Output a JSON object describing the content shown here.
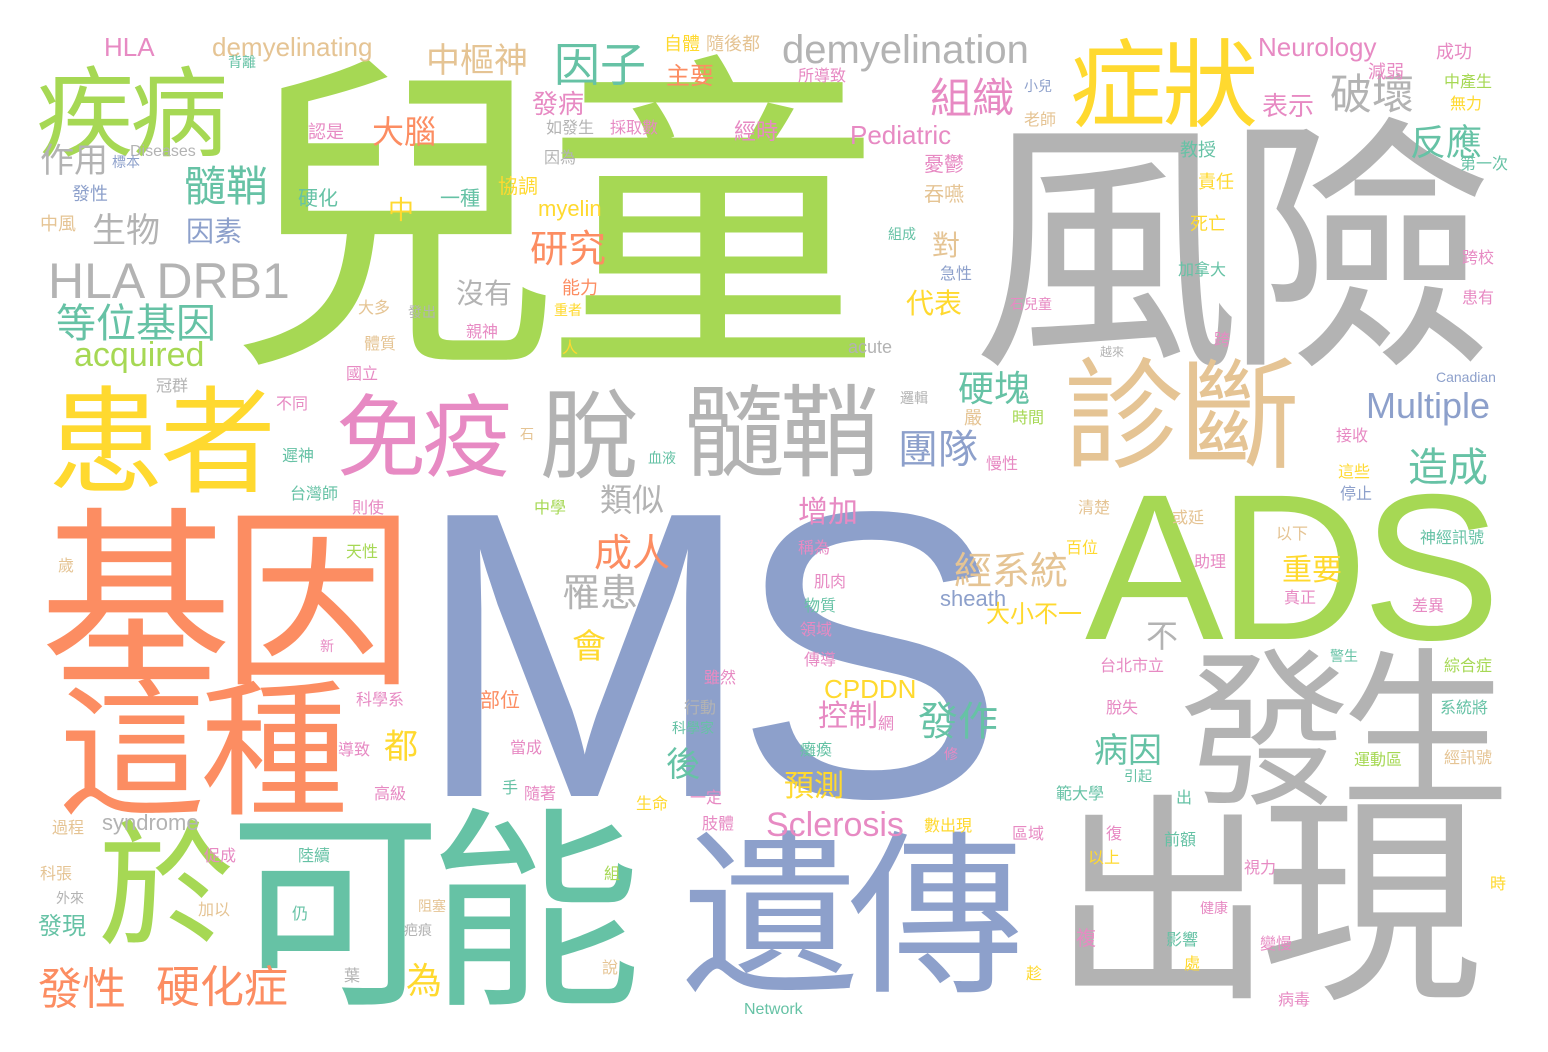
{
  "colors": {
    "green": "#a6d854",
    "blue": "#8da0cb",
    "orange": "#fc8d62",
    "teal": "#66c2a5",
    "gray": "#b3b3b3",
    "yellow": "#ffd92f",
    "pink": "#e78ac3",
    "tan": "#e5c494"
  },
  "words": [
    {
      "text": "MS",
      "color": "blue"
    },
    {
      "text": "兒童",
      "color": "green"
    },
    {
      "text": "風險",
      "color": "gray"
    },
    {
      "text": "ADS",
      "color": "green"
    },
    {
      "text": "基因",
      "color": "orange"
    },
    {
      "text": "可能",
      "color": "teal"
    },
    {
      "text": "遺傳",
      "color": "blue"
    },
    {
      "text": "出現",
      "color": "gray"
    },
    {
      "text": "發生",
      "color": "gray"
    },
    {
      "text": "這種",
      "color": "orange"
    },
    {
      "text": "患者",
      "color": "yellow"
    },
    {
      "text": "診斷",
      "color": "tan"
    },
    {
      "text": "疾病",
      "color": "green"
    },
    {
      "text": "症狀",
      "color": "yellow"
    },
    {
      "text": "於",
      "color": "green"
    },
    {
      "text": "免疫",
      "color": "pink"
    },
    {
      "text": "脫",
      "color": "gray"
    },
    {
      "text": "髓鞘",
      "color": "gray"
    },
    {
      "text": "HLA DRB1",
      "color": "gray"
    },
    {
      "text": "demyelination",
      "color": "gray"
    },
    {
      "text": "因子",
      "color": "teal"
    },
    {
      "text": "中樞神",
      "color": "tan"
    },
    {
      "text": "組織",
      "color": "pink"
    },
    {
      "text": "破壞",
      "color": "gray"
    },
    {
      "text": "作用",
      "color": "gray"
    },
    {
      "text": "髓鞘",
      "color": "teal"
    },
    {
      "text": "生物",
      "color": "gray"
    },
    {
      "text": "因素",
      "color": "blue"
    },
    {
      "text": "等位基因",
      "color": "teal"
    },
    {
      "text": "acquired",
      "color": "green"
    },
    {
      "text": "大腦",
      "color": "orange"
    },
    {
      "text": "研究",
      "color": "orange"
    },
    {
      "text": "反應",
      "color": "teal"
    },
    {
      "text": "Multiple",
      "color": "blue"
    },
    {
      "text": "硬塊",
      "color": "teal"
    },
    {
      "text": "團隊",
      "color": "blue"
    },
    {
      "text": "造成",
      "color": "teal"
    },
    {
      "text": "Sclerosis",
      "color": "pink"
    },
    {
      "text": "成人",
      "color": "orange"
    },
    {
      "text": "罹患",
      "color": "gray"
    },
    {
      "text": "類似",
      "color": "gray"
    },
    {
      "text": "發作",
      "color": "teal"
    },
    {
      "text": "經系統",
      "color": "tan"
    },
    {
      "text": "病因",
      "color": "teal"
    },
    {
      "text": "發性",
      "color": "orange"
    },
    {
      "text": "硬化症",
      "color": "orange"
    },
    {
      "text": "Neurology",
      "color": "pink"
    },
    {
      "text": "demyelinating",
      "color": "tan"
    },
    {
      "text": "HLA",
      "color": "pink"
    },
    {
      "text": "Pediatric",
      "color": "pink"
    },
    {
      "text": "myelin",
      "color": "yellow"
    },
    {
      "text": "sheath",
      "color": "blue"
    },
    {
      "text": "CPDDN",
      "color": "yellow"
    },
    {
      "text": "syndrome",
      "color": "gray"
    },
    {
      "text": "acute",
      "color": "gray"
    },
    {
      "text": "Network",
      "color": "teal"
    },
    {
      "text": "Canadian",
      "color": "blue"
    },
    {
      "text": "Diseases",
      "color": "gray"
    },
    {
      "text": "發病",
      "color": "pink"
    },
    {
      "text": "主要",
      "color": "orange"
    },
    {
      "text": "表示",
      "color": "pink"
    },
    {
      "text": "增加",
      "color": "pink"
    },
    {
      "text": "預測",
      "color": "yellow"
    },
    {
      "text": "控制",
      "color": "pink"
    },
    {
      "text": "重要",
      "color": "yellow"
    },
    {
      "text": "為",
      "color": "yellow"
    },
    {
      "text": "都",
      "color": "yellow"
    },
    {
      "text": "後",
      "color": "teal"
    },
    {
      "text": "會",
      "color": "yellow"
    },
    {
      "text": "對",
      "color": "tan"
    },
    {
      "text": "代表",
      "color": "yellow"
    },
    {
      "text": "沒有",
      "color": "gray"
    },
    {
      "text": "不",
      "color": "gray"
    },
    {
      "text": "中",
      "color": "yellow"
    },
    {
      "text": "一種",
      "color": "teal"
    },
    {
      "text": "協調",
      "color": "yellow"
    },
    {
      "text": "硬化",
      "color": "teal"
    },
    {
      "text": "發性",
      "color": "blue"
    },
    {
      "text": "中風",
      "color": "tan"
    },
    {
      "text": "能力",
      "color": "orange"
    },
    {
      "text": "大小不一",
      "color": "yellow"
    },
    {
      "text": "經時",
      "color": "pink"
    },
    {
      "text": "認是",
      "color": "pink"
    },
    {
      "text": "自體",
      "color": "yellow"
    },
    {
      "text": "隨後都",
      "color": "tan"
    },
    {
      "text": "所導致",
      "color": "pink"
    },
    {
      "text": "如發生",
      "color": "gray"
    },
    {
      "text": "採取數",
      "color": "pink"
    },
    {
      "text": "因為",
      "color": "gray"
    },
    {
      "text": "小兒",
      "color": "blue"
    },
    {
      "text": "老師",
      "color": "tan"
    },
    {
      "text": "憂鬱",
      "color": "pink"
    },
    {
      "text": "吞嚥",
      "color": "tan"
    },
    {
      "text": "教授",
      "color": "teal"
    },
    {
      "text": "責任",
      "color": "yellow"
    },
    {
      "text": "死亡",
      "color": "yellow"
    },
    {
      "text": "加拿大",
      "color": "teal"
    },
    {
      "text": "成功",
      "color": "pink"
    },
    {
      "text": "減弱",
      "color": "pink"
    },
    {
      "text": "中產生",
      "color": "green"
    },
    {
      "text": "無力",
      "color": "yellow"
    },
    {
      "text": "第一次",
      "color": "teal"
    },
    {
      "text": "跨校",
      "color": "pink"
    },
    {
      "text": "患有",
      "color": "pink"
    },
    {
      "text": "組成",
      "color": "teal"
    },
    {
      "text": "急性",
      "color": "blue"
    },
    {
      "text": "石兒童",
      "color": "pink"
    },
    {
      "text": "跨",
      "color": "pink"
    },
    {
      "text": "越來",
      "color": "gray"
    },
    {
      "text": "邏輯",
      "color": "gray"
    },
    {
      "text": "嚴",
      "color": "tan"
    },
    {
      "text": "時間",
      "color": "green"
    },
    {
      "text": "慢性",
      "color": "pink"
    },
    {
      "text": "接收",
      "color": "pink"
    },
    {
      "text": "這些",
      "color": "yellow"
    },
    {
      "text": "停止",
      "color": "blue"
    },
    {
      "text": "清楚",
      "color": "tan"
    },
    {
      "text": "或延",
      "color": "tan"
    },
    {
      "text": "百位",
      "color": "yellow"
    },
    {
      "text": "以下",
      "color": "tan"
    },
    {
      "text": "助理",
      "color": "pink"
    },
    {
      "text": "真正",
      "color": "pink"
    },
    {
      "text": "差異",
      "color": "pink"
    },
    {
      "text": "神經訊號",
      "color": "teal"
    },
    {
      "text": "綜合症",
      "color": "green"
    },
    {
      "text": "警生",
      "color": "teal"
    },
    {
      "text": "系統將",
      "color": "teal"
    },
    {
      "text": "經訊號",
      "color": "tan"
    },
    {
      "text": "運動區",
      "color": "green"
    },
    {
      "text": "台北市立",
      "color": "pink"
    },
    {
      "text": "脫失",
      "color": "pink"
    },
    {
      "text": "引起",
      "color": "teal"
    },
    {
      "text": "出",
      "color": "teal"
    },
    {
      "text": "範大學",
      "color": "teal"
    },
    {
      "text": "復",
      "color": "pink"
    },
    {
      "text": "以上",
      "color": "yellow"
    },
    {
      "text": "前額",
      "color": "teal"
    },
    {
      "text": "區域",
      "color": "pink"
    },
    {
      "text": "數出現",
      "color": "yellow"
    },
    {
      "text": "視力",
      "color": "pink"
    },
    {
      "text": "健康",
      "color": "pink"
    },
    {
      "text": "影響",
      "color": "teal"
    },
    {
      "text": "處",
      "color": "yellow"
    },
    {
      "text": "變慢",
      "color": "pink"
    },
    {
      "text": "病毒",
      "color": "pink"
    },
    {
      "text": "時",
      "color": "yellow"
    },
    {
      "text": "稱為",
      "color": "pink"
    },
    {
      "text": "肌肉",
      "color": "pink"
    },
    {
      "text": "物質",
      "color": "teal"
    },
    {
      "text": "領域",
      "color": "pink"
    },
    {
      "text": "傳導",
      "color": "pink"
    },
    {
      "text": "雖然",
      "color": "pink"
    },
    {
      "text": "行動",
      "color": "gray"
    },
    {
      "text": "科學家",
      "color": "teal"
    },
    {
      "text": "網",
      "color": "pink"
    },
    {
      "text": "癱瘓",
      "color": "teal"
    },
    {
      "text": "修",
      "color": "pink"
    },
    {
      "text": "一定",
      "color": "pink"
    },
    {
      "text": "生命",
      "color": "yellow"
    },
    {
      "text": "肢體",
      "color": "pink"
    },
    {
      "text": "隨著",
      "color": "pink"
    },
    {
      "text": "部位",
      "color": "orange"
    },
    {
      "text": "當成",
      "color": "pink"
    },
    {
      "text": "手",
      "color": "teal"
    },
    {
      "text": "導致",
      "color": "pink"
    },
    {
      "text": "高級",
      "color": "pink"
    },
    {
      "text": "科學系",
      "color": "pink"
    },
    {
      "text": "新",
      "color": "pink"
    },
    {
      "text": "天性",
      "color": "green"
    },
    {
      "text": "中學",
      "color": "green"
    },
    {
      "text": "台灣師",
      "color": "teal"
    },
    {
      "text": "則使",
      "color": "pink"
    },
    {
      "text": "遲神",
      "color": "teal"
    },
    {
      "text": "石",
      "color": "tan"
    },
    {
      "text": "血液",
      "color": "teal"
    },
    {
      "text": "不同",
      "color": "pink"
    },
    {
      "text": "國立",
      "color": "pink"
    },
    {
      "text": "體質",
      "color": "tan"
    },
    {
      "text": "大多",
      "color": "tan"
    },
    {
      "text": "發出",
      "color": "gray"
    },
    {
      "text": "冠群",
      "color": "gray"
    },
    {
      "text": "親神",
      "color": "pink"
    },
    {
      "text": "人",
      "color": "yellow"
    },
    {
      "text": "重者",
      "color": "yellow"
    },
    {
      "text": "標本",
      "color": "blue"
    },
    {
      "text": "背離",
      "color": "teal"
    },
    {
      "text": "過程",
      "color": "tan"
    },
    {
      "text": "促成",
      "color": "pink"
    },
    {
      "text": "陸續",
      "color": "teal"
    },
    {
      "text": "組",
      "color": "green"
    },
    {
      "text": "科張",
      "color": "tan"
    },
    {
      "text": "外來",
      "color": "gray"
    },
    {
      "text": "加以",
      "color": "tan"
    },
    {
      "text": "發現",
      "color": "teal"
    },
    {
      "text": "仍",
      "color": "teal"
    },
    {
      "text": "阻塞",
      "color": "tan"
    },
    {
      "text": "疤痕",
      "color": "gray"
    },
    {
      "text": "葉",
      "color": "gray"
    },
    {
      "text": "說",
      "color": "tan"
    },
    {
      "text": "複",
      "color": "pink"
    },
    {
      "text": "趁",
      "color": "yellow"
    },
    {
      "text": "歲",
      "color": "tan"
    }
  ]
}
